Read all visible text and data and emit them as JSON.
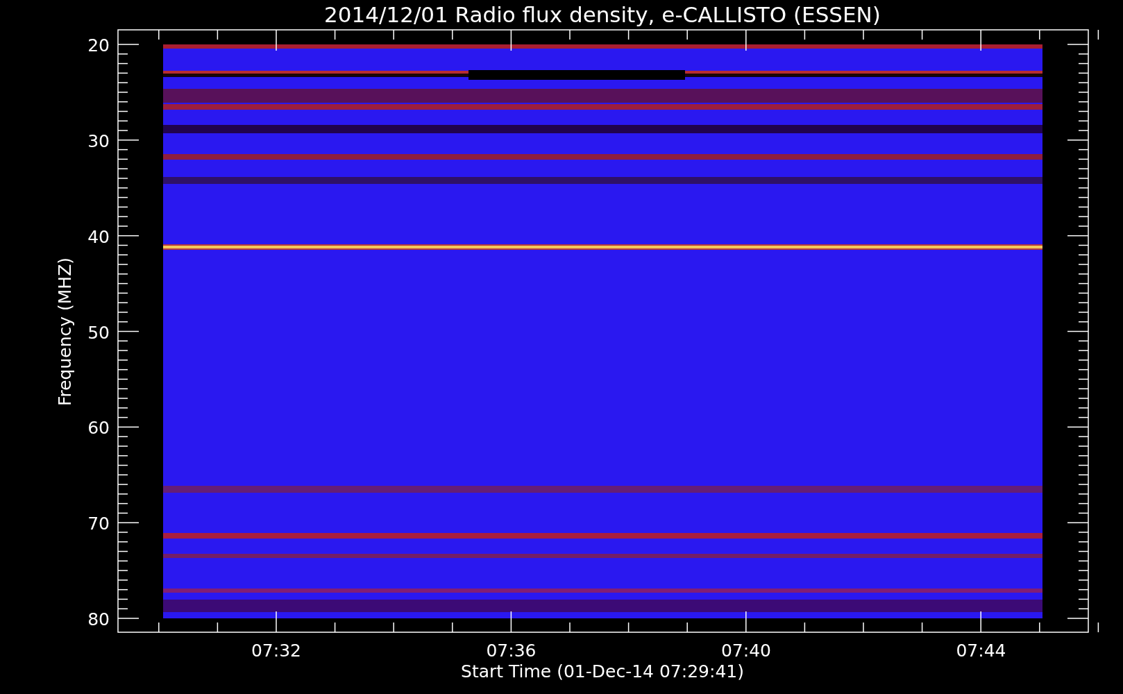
{
  "chart": {
    "title": "2014/12/01  Radio flux density, e-CALLISTO (ESSEN)",
    "ylabel": "Frequency (MHZ)",
    "xlabel": "Start Time (01-Dec-14 07:29:41)",
    "yticks": [
      "20",
      "30",
      "40",
      "50",
      "60",
      "70",
      "80"
    ],
    "xticks": [
      "07:32",
      "07:36",
      "07:40",
      "07:44"
    ]
  }
}
